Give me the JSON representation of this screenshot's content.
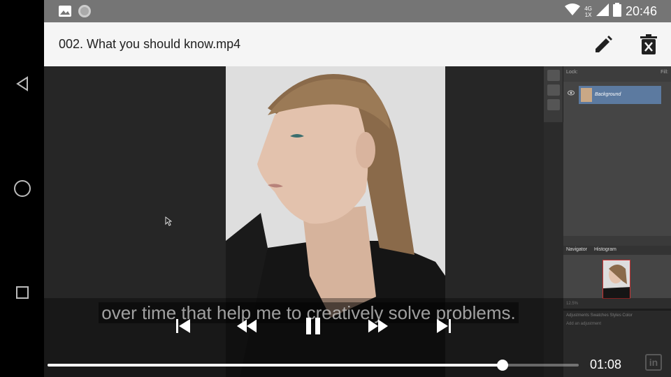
{
  "status_bar": {
    "time": "20:46",
    "network_top": "4G",
    "network_bottom": "1X",
    "icons": [
      "image-icon",
      "circle-icon",
      "wifi-icon",
      "cell-signal-icon",
      "battery-icon"
    ]
  },
  "nav_bar": {
    "icons": [
      "back-icon",
      "home-icon",
      "recents-icon"
    ]
  },
  "header": {
    "title": "002. What you should know.mp4",
    "actions": [
      "edit-icon",
      "delete-icon"
    ]
  },
  "video": {
    "subtitle": "over time that help me to creatively solve problems.",
    "controls": [
      "skip-previous-icon",
      "rewind-icon",
      "pause-icon",
      "fast-forward-icon",
      "skip-next-icon"
    ],
    "elapsed": "01:08",
    "progress": 0.857,
    "watermark": "in",
    "photoshop": {
      "lock_label": "Lock:",
      "fill_label": "Fill:",
      "layer_name": "Background",
      "tab_navigator": "Navigator",
      "tab_histogram": "Histogram",
      "zoom": "12.5%",
      "adj_tabs": "Adjustments  Swatches  Styles  Color",
      "adj_hint": "Add an adjustment"
    }
  },
  "colors": {
    "status_bar": "#757575",
    "app_bar": "#f5f5f5",
    "layer_selected": "#5c7aa0"
  }
}
